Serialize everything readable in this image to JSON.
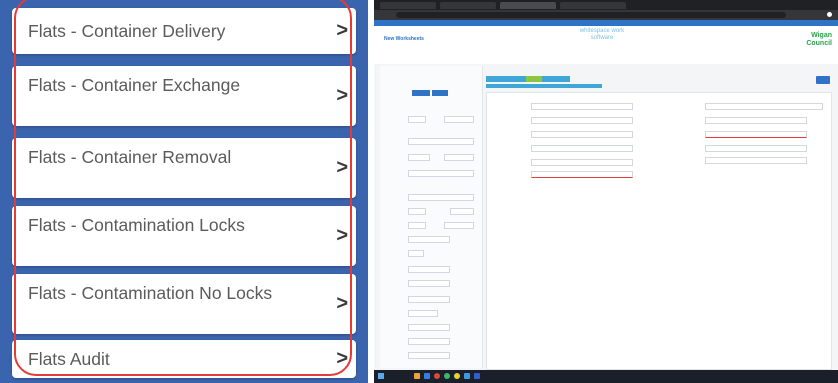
{
  "left_menu": {
    "items": [
      {
        "label": "Flats - Container Delivery",
        "chevron": ">"
      },
      {
        "label": "Flats - Container Exchange",
        "chevron": ">"
      },
      {
        "label": "Flats - Container Removal",
        "chevron": ">"
      },
      {
        "label": "Flats - Contamination Locks",
        "chevron": ">"
      },
      {
        "label": "Flats - Contamination No Locks",
        "chevron": ">"
      },
      {
        "label": "Flats Audit",
        "chevron": ">"
      }
    ],
    "colors": {
      "background": "#3a64ad",
      "highlight": "#e53a3a"
    }
  },
  "web_screenshot": {
    "page_heading": "New Worksheets",
    "logo_text": "whitespace work software",
    "council_logo": "Wigan Council",
    "accent": "#2e73c6"
  }
}
